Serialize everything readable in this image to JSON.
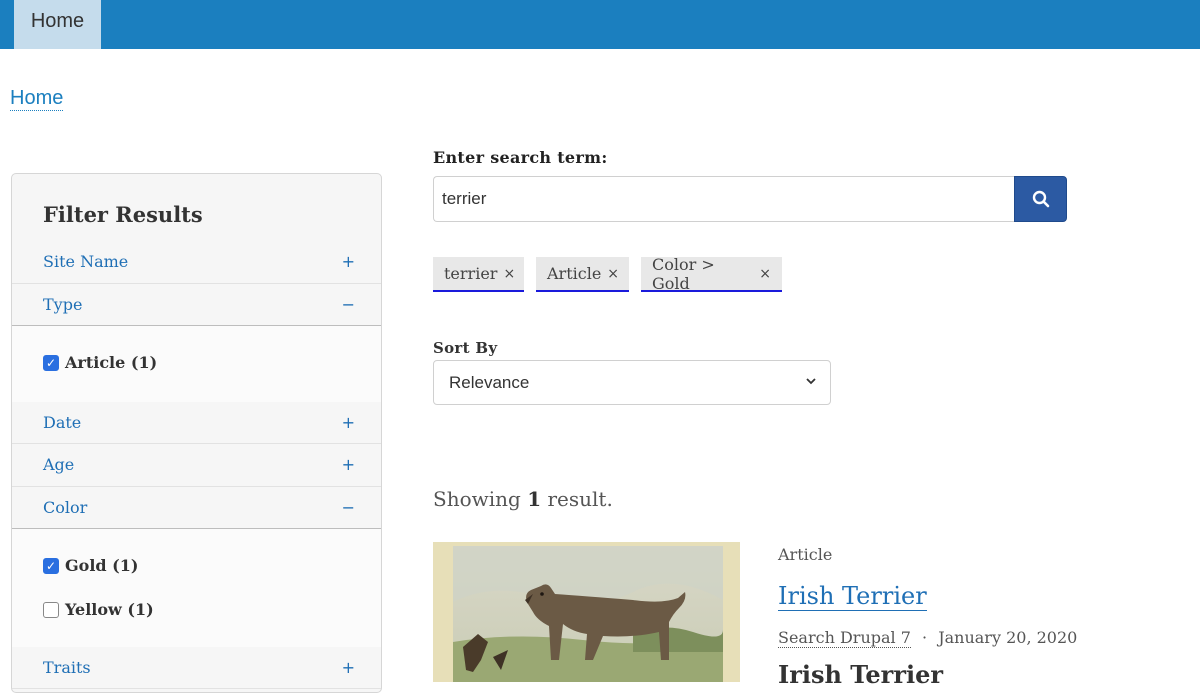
{
  "topnav": {
    "home_label": "Home"
  },
  "breadcrumb": {
    "home_label": "Home"
  },
  "sidebar": {
    "title": "Filter Results",
    "facets": [
      {
        "label": "Site Name",
        "toggle": "+"
      },
      {
        "label": "Type",
        "toggle": "−",
        "options": [
          {
            "label": "Article (1)",
            "checked": true
          }
        ]
      },
      {
        "label": "Date",
        "toggle": "+"
      },
      {
        "label": "Age",
        "toggle": "+"
      },
      {
        "label": "Color",
        "toggle": "−",
        "options": [
          {
            "label": "Gold (1)",
            "checked": true
          },
          {
            "label": "Yellow (1)",
            "checked": false
          }
        ]
      },
      {
        "label": "Traits",
        "toggle": "+"
      }
    ]
  },
  "search": {
    "label": "Enter search term:",
    "value": "terrier",
    "button_icon": "search-icon"
  },
  "active_filters": [
    {
      "label": "terrier",
      "remove": "×"
    },
    {
      "label": "Article",
      "remove": "×"
    },
    {
      "label": "Color > Gold",
      "remove": "×"
    }
  ],
  "sort": {
    "label": "Sort By",
    "selected": "Relevance"
  },
  "results": {
    "count_prefix": "Showing ",
    "count": "1",
    "count_suffix": " result.",
    "items": [
      {
        "type": "Article",
        "title": "Irish Terrier",
        "site": "Search Drupal 7",
        "separator": "·",
        "date": "January 20, 2020",
        "snippet": "Irish Terrier"
      }
    ]
  },
  "colors": {
    "topbar": "#1b7fbf",
    "link": "#1f6fb5",
    "search_button": "#2c5aa3",
    "checkbox": "#2a6fe0",
    "chip_underline": "#1a1adb"
  }
}
